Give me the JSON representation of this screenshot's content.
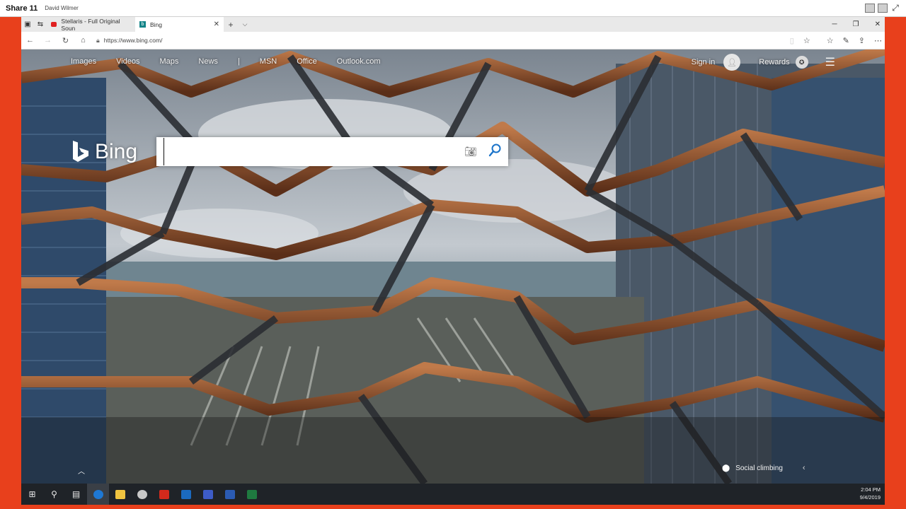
{
  "share": {
    "title": "Share 11",
    "user": "David Wilmer"
  },
  "browser": {
    "tabs": [
      {
        "label": "Stellaris - Full Original Soun",
        "active": false
      },
      {
        "label": "Bing",
        "active": true
      }
    ],
    "url": "https://www.bing.com/"
  },
  "bing": {
    "nav_items": [
      "Images",
      "Videos",
      "Maps",
      "News",
      "|",
      "MSN",
      "Office",
      "Outlook.com"
    ],
    "sign_in": "Sign in",
    "rewards": "Rewards",
    "logo_text": "Bing",
    "search": {
      "value": "",
      "placeholder": ""
    },
    "image_caption": "Social climbing"
  },
  "taskbar": {
    "time": "2:04 PM",
    "date": "9/4/2019"
  },
  "colors": {
    "frame_red": "#e8401c",
    "taskbar": "#1f2328",
    "bing_teal": "#138488",
    "search_blue": "#1a73c9"
  }
}
